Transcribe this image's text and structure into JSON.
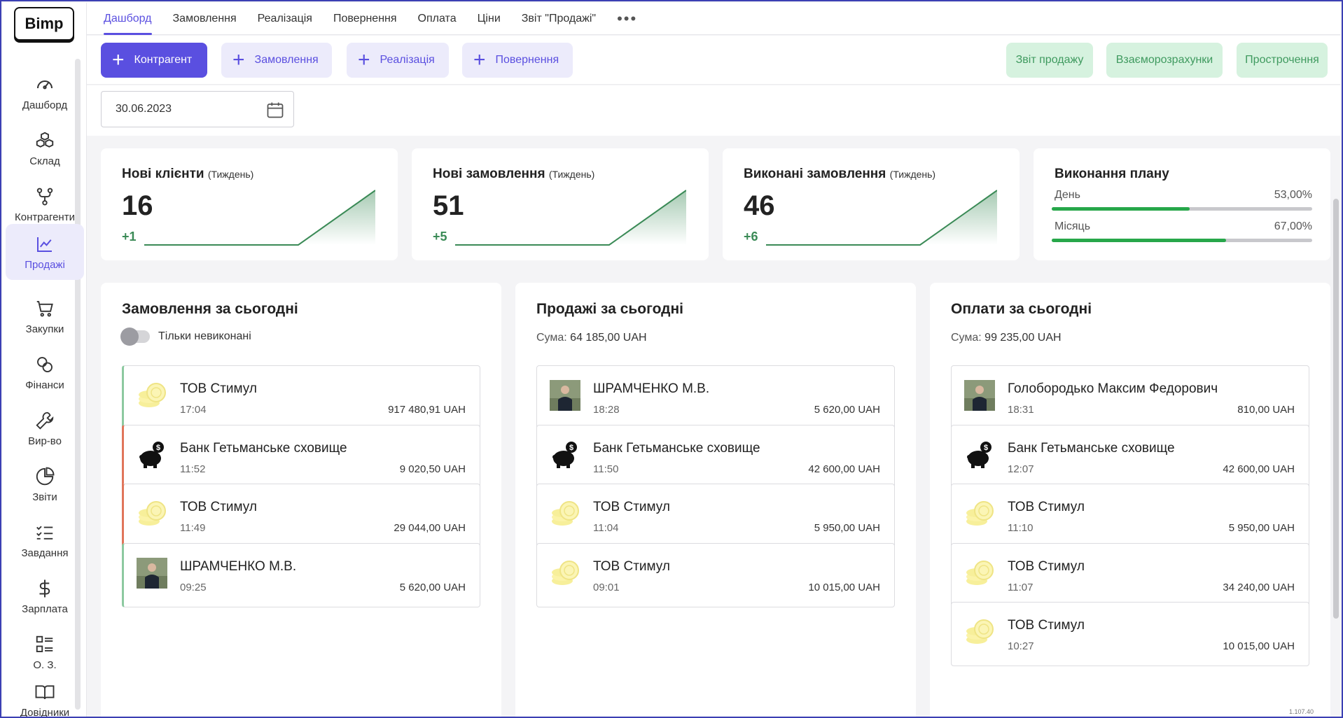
{
  "logo": "Bimp",
  "sidebar": {
    "items": [
      {
        "label": "Дашборд",
        "icon": "gauge-icon"
      },
      {
        "label": "Склад",
        "icon": "boxes-icon"
      },
      {
        "label": "Контрагенти",
        "icon": "branch-icon"
      },
      {
        "label": "Продажі",
        "icon": "chart-line-icon"
      },
      {
        "label": "Закупки",
        "icon": "cart-icon"
      },
      {
        "label": "Фінанси",
        "icon": "coins-icon"
      },
      {
        "label": "Вир-во",
        "icon": "wrench-icon"
      },
      {
        "label": "Звіти",
        "icon": "pie-chart-icon"
      },
      {
        "label": "Завдання",
        "icon": "checklist-icon"
      },
      {
        "label": "Зарплата",
        "icon": "dollar-icon"
      },
      {
        "label": "О. З.",
        "icon": "grid-list-icon"
      },
      {
        "label": "Довідники",
        "icon": "book-icon"
      }
    ],
    "active": "Продажі"
  },
  "tabs": [
    {
      "label": "Дашборд"
    },
    {
      "label": "Замовлення"
    },
    {
      "label": "Реалізація"
    },
    {
      "label": "Повернення"
    },
    {
      "label": "Оплата"
    },
    {
      "label": "Ціни"
    },
    {
      "label": "Звіт \"Продажі\""
    }
  ],
  "actions": {
    "contractor": "Контрагент",
    "order": "Замовлення",
    "realization": "Реалізація",
    "return": "Повернення",
    "sales_report": "Звіт продажу",
    "settlements": "Взаєморозрахунки",
    "overdue": "Прострочення"
  },
  "date": "30.06.2023",
  "kpis": {
    "new_clients": {
      "title": "Нові клієнти",
      "period": "(Тиждень)",
      "value": "16",
      "delta": "+1"
    },
    "new_orders": {
      "title": "Нові замовлення",
      "period": "(Тиждень)",
      "value": "51",
      "delta": "+5"
    },
    "done_orders": {
      "title": "Виконані замовлення",
      "period": "(Тиждень)",
      "value": "46",
      "delta": "+6"
    },
    "plan": {
      "title": "Виконання плану",
      "day_label": "День",
      "day_pct": "53,00%",
      "day_value": 0.53,
      "month_label": "Місяць",
      "month_pct": "67,00%",
      "month_value": 0.67
    }
  },
  "orders": {
    "title": "Замовлення за сьогодні",
    "toggle_label": "Тільки невиконані",
    "items": [
      {
        "name": "ТОВ Стимул",
        "time": "17:04",
        "amount": "917 480,91 UAH",
        "avatar": "coins-avatar-icon"
      },
      {
        "name": "Банк Гетьманське сховище",
        "time": "11:52",
        "amount": "9 020,50 UAH",
        "avatar": "piggy-bank-icon"
      },
      {
        "name": "ТОВ Стимул",
        "time": "11:49",
        "amount": "29 044,00 UAH",
        "avatar": "coins-avatar-icon"
      },
      {
        "name": "ШРАМЧЕНКО М.В.",
        "time": "09:25",
        "amount": "5 620,00 UAH",
        "avatar": "person-photo"
      }
    ]
  },
  "sales": {
    "title": "Продажі за сьогодні",
    "sum_label": "Сума:",
    "sum_value": "64 185,00 UAH",
    "items": [
      {
        "name": "ШРАМЧЕНКО М.В.",
        "time": "18:28",
        "amount": "5 620,00 UAH",
        "avatar": "person-photo"
      },
      {
        "name": "Банк Гетьманське сховище",
        "time": "11:50",
        "amount": "42 600,00 UAH",
        "avatar": "piggy-bank-icon"
      },
      {
        "name": "ТОВ Стимул",
        "time": "11:04",
        "amount": "5 950,00 UAH",
        "avatar": "coins-avatar-icon"
      },
      {
        "name": "ТОВ Стимул",
        "time": "09:01",
        "amount": "10 015,00 UAH",
        "avatar": "coins-avatar-icon"
      }
    ]
  },
  "payments": {
    "title": "Оплати за сьогодні",
    "sum_label": "Сума:",
    "sum_value": "99 235,00 UAH",
    "items": [
      {
        "name": "Голобородько Максим Федорович",
        "time": "18:31",
        "amount": "810,00 UAH",
        "avatar": "person-photo"
      },
      {
        "name": "Банк Гетьманське сховище",
        "time": "12:07",
        "amount": "42 600,00 UAH",
        "avatar": "piggy-bank-icon"
      },
      {
        "name": "ТОВ Стимул",
        "time": "11:10",
        "amount": "5 950,00 UAH",
        "avatar": "coins-avatar-icon"
      },
      {
        "name": "ТОВ Стимул",
        "time": "11:07",
        "amount": "34 240,00 UAH",
        "avatar": "coins-avatar-icon"
      },
      {
        "name": "ТОВ Стимул",
        "time": "10:27",
        "amount": "10 015,00 UAH",
        "avatar": "coins-avatar-icon"
      }
    ]
  },
  "version": "1.107.40",
  "colors": {
    "accent": "#5a4fe0",
    "green": "#27a74a",
    "soft_green": "#d6f2df"
  }
}
